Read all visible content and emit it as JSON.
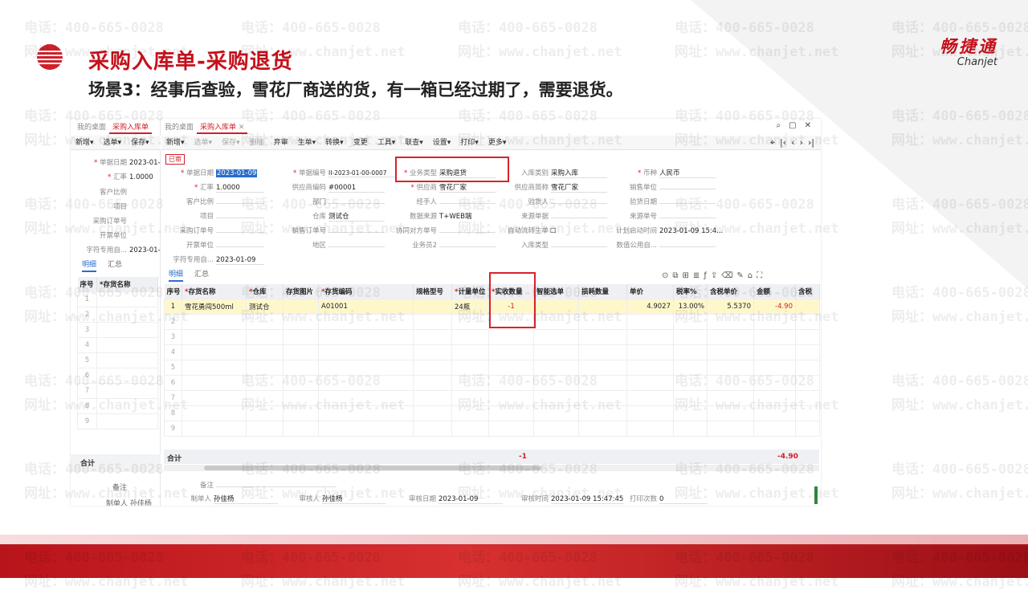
{
  "slide": {
    "title": "采购入库单-采购退货",
    "subtitle": "场景3：经事后查验，雪花厂商送的货，有一箱已经过期了，需要退货。",
    "brand_cn": "畅捷通",
    "brand_en": "Chanjet",
    "watermark_phone": "电话：400-665-0028",
    "watermark_site": "网址：www.chanjet.net",
    "accent_color": "#c4111b"
  },
  "left_pane": {
    "tabs": [
      "我的桌面",
      "采购入库单"
    ],
    "toolbar": [
      "新增▾",
      "选单▾",
      "保存▾"
    ],
    "fields": [
      {
        "label": "单据日期",
        "value": "2023-01-"
      },
      {
        "label": "汇率",
        "value": "1.0000"
      },
      {
        "label": "客户比例",
        "value": ""
      },
      {
        "label": "项目",
        "value": ""
      },
      {
        "label": "采购订单号",
        "value": ""
      },
      {
        "label": "开票单位",
        "value": ""
      },
      {
        "label": "字符专用自...",
        "value": "2023-01-"
      }
    ],
    "subtabs": [
      "明细",
      "汇总"
    ],
    "grid_headers": [
      "序号",
      "*存货名称"
    ],
    "rows": [
      "1",
      "2",
      "3",
      "4",
      "5",
      "6",
      "7",
      "8",
      "9"
    ],
    "sum_label": "合计",
    "memo_label": "备注",
    "maker": "制单人 孙佳杨"
  },
  "app": {
    "tabs": [
      {
        "label": "我的桌面",
        "active": false
      },
      {
        "label": "采购入库单",
        "active": true
      }
    ],
    "toolbar": [
      {
        "label": "新增▾",
        "enabled": true
      },
      {
        "label": "选单▾",
        "enabled": false
      },
      {
        "label": "保存▾",
        "enabled": false
      },
      {
        "label": "删除",
        "enabled": false
      },
      {
        "label": "弃审",
        "enabled": true
      },
      {
        "label": "生单▾",
        "enabled": true
      },
      {
        "label": "转换▾",
        "enabled": true
      },
      {
        "label": "变更",
        "enabled": true
      },
      {
        "label": "工具▾",
        "enabled": true
      },
      {
        "label": "联查▾",
        "enabled": true
      },
      {
        "label": "设置▾",
        "enabled": true
      },
      {
        "label": "打印▾",
        "enabled": true
      },
      {
        "label": "更多▾",
        "enabled": true
      }
    ],
    "status": "已审",
    "header_fields": {
      "date": {
        "label": "单据日期",
        "value": "2023-01-09"
      },
      "code": {
        "label": "单据编号",
        "value": "II-2023-01-00-0007"
      },
      "biztype": {
        "label": "业务类型",
        "value": "采购退货"
      },
      "instock_type": {
        "label": "入库类别",
        "value": "采购入库"
      },
      "currency": {
        "label": "币种",
        "value": "人民币"
      },
      "rate": {
        "label": "汇率",
        "value": "1.0000"
      },
      "vendor_code": {
        "label": "供应商编码",
        "value": "#00001"
      },
      "vendor": {
        "label": "供应商",
        "value": "雪花厂家"
      },
      "vendor_short": {
        "label": "供应商简称",
        "value": "雪花厂家"
      },
      "sales_unit": {
        "label": "销售单位",
        "value": ""
      },
      "cust_ratio": {
        "label": "客户比例",
        "value": ""
      },
      "dept": {
        "label": "部门",
        "value": ""
      },
      "handler": {
        "label": "经手人",
        "value": ""
      },
      "checker": {
        "label": "验货人",
        "value": ""
      },
      "check_date": {
        "label": "验货日期",
        "value": ""
      },
      "project": {
        "label": "项目",
        "value": ""
      },
      "warehouse": {
        "label": "仓库",
        "value": "测试仓"
      },
      "data_source": {
        "label": "数据来源",
        "value": "T+WEB端"
      },
      "src_doc": {
        "label": "来源单据",
        "value": ""
      },
      "src_code": {
        "label": "来源单号",
        "value": ""
      },
      "po_no": {
        "label": "采购订单号",
        "value": ""
      },
      "so_no": {
        "label": "销售订单号",
        "value": ""
      },
      "coop_no": {
        "label": "协同对方单号",
        "value": ""
      },
      "auto_flow": {
        "label": "自动流转生单",
        "value": "☐"
      },
      "plan_time": {
        "label": "计划启动时间",
        "value": "2023-01-09 15:4..."
      },
      "invoice_unit": {
        "label": "开票单位",
        "value": ""
      },
      "region": {
        "label": "地区",
        "value": ""
      },
      "staff2": {
        "label": "业务员2",
        "value": ""
      },
      "instock_type2": {
        "label": "入库类型",
        "value": ""
      },
      "num_custom": {
        "label": "数值公用自...",
        "value": ""
      },
      "char_custom": {
        "label": "字符专用自...",
        "value": "2023-01-09"
      }
    },
    "subtabs": [
      "明细",
      "汇总"
    ],
    "grid": {
      "headers": [
        {
          "label": "序号",
          "req": false
        },
        {
          "label": "存货名称",
          "req": true
        },
        {
          "label": "仓库",
          "req": true
        },
        {
          "label": "存货图片",
          "req": false
        },
        {
          "label": "存货编码",
          "req": true
        },
        {
          "label": "规格型号",
          "req": false
        },
        {
          "label": "计量单位",
          "req": true
        },
        {
          "label": "实收数量",
          "req": true
        },
        {
          "label": "智能选单",
          "req": false
        },
        {
          "label": "损耗数量",
          "req": false
        },
        {
          "label": "单价",
          "req": false
        },
        {
          "label": "税率%",
          "req": false
        },
        {
          "label": "含税单价",
          "req": false
        },
        {
          "label": "金额",
          "req": false
        },
        {
          "label": "含税",
          "req": false
        }
      ],
      "rows": [
        [
          "1",
          "雪花勇闯500ml",
          "测试仓",
          "",
          "A01001",
          "",
          "24瓶",
          "-1",
          "",
          "",
          "4.9027",
          "13.00%",
          "5.5370",
          "-4.90",
          ""
        ],
        [
          "2",
          "",
          "",
          "",
          "",
          "",
          "",
          "",
          "",
          "",
          "",
          "",
          "",
          "",
          ""
        ],
        [
          "3",
          "",
          "",
          "",
          "",
          "",
          "",
          "",
          "",
          "",
          "",
          "",
          "",
          "",
          ""
        ],
        [
          "4",
          "",
          "",
          "",
          "",
          "",
          "",
          "",
          "",
          "",
          "",
          "",
          "",
          "",
          ""
        ],
        [
          "5",
          "",
          "",
          "",
          "",
          "",
          "",
          "",
          "",
          "",
          "",
          "",
          "",
          "",
          ""
        ],
        [
          "6",
          "",
          "",
          "",
          "",
          "",
          "",
          "",
          "",
          "",
          "",
          "",
          "",
          "",
          ""
        ],
        [
          "7",
          "",
          "",
          "",
          "",
          "",
          "",
          "",
          "",
          "",
          "",
          "",
          "",
          "",
          ""
        ],
        [
          "8",
          "",
          "",
          "",
          "",
          "",
          "",
          "",
          "",
          "",
          "",
          "",
          "",
          "",
          ""
        ],
        [
          "9",
          "",
          "",
          "",
          "",
          "",
          "",
          "",
          "",
          "",
          "",
          "",
          "",
          "",
          ""
        ]
      ]
    },
    "sum": {
      "label": "合计",
      "qty": "-1",
      "amount": "-4.90"
    },
    "footer": {
      "memo": {
        "label": "备注",
        "value": ""
      },
      "maker": {
        "label": "制单人",
        "value": "孙佳杨"
      },
      "auditor": {
        "label": "审核人",
        "value": "孙佳杨"
      },
      "audit_date": {
        "label": "审核日期",
        "value": "2023-01-09"
      },
      "audit_time": {
        "label": "审核时间",
        "value": "2023-01-09 15:47:45"
      },
      "print_count": {
        "label": "打印次数",
        "value": "0"
      }
    }
  }
}
